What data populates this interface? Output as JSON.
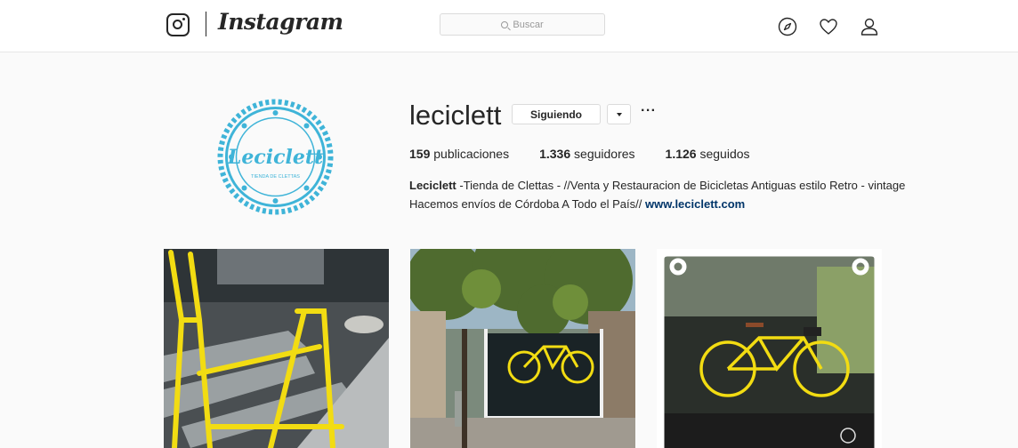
{
  "topbar": {
    "brand": "Instagram",
    "search": {
      "placeholder": "Buscar"
    },
    "icons": [
      "compass-icon",
      "heart-icon",
      "person-icon"
    ]
  },
  "profile": {
    "username": "leciclett",
    "follow_label": "Siguiendo",
    "more_label": "···",
    "avatar": {
      "script": "Leciclett",
      "tagline": "TIENDA DE CLETTAS",
      "color": "#3fb4d8"
    },
    "stats": [
      {
        "value": "159",
        "label": "publicaciones"
      },
      {
        "value": "1.336",
        "label": "seguidores"
      },
      {
        "value": "1.126",
        "label": "seguidos"
      }
    ],
    "bio": {
      "name": "Leciclett",
      "text": " -Tienda de Clettas - //Venta y Restauracion de Bicicletas Antiguas estilo Retro - vintage Hacemos envíos de Córdoba A Todo el País// ",
      "link": "www.leciclett.com"
    }
  },
  "posts": [
    {
      "alt": "yellow-bicycle-frame-on-bench"
    },
    {
      "alt": "storefront-with-tree-and-yellow-bicycle"
    },
    {
      "alt": "yellow-bicycle-in-shop-window"
    }
  ],
  "colors": {
    "accent_link": "#003569",
    "logo_blue": "#3fb4d8",
    "bike_yellow": "#f2dc12"
  }
}
